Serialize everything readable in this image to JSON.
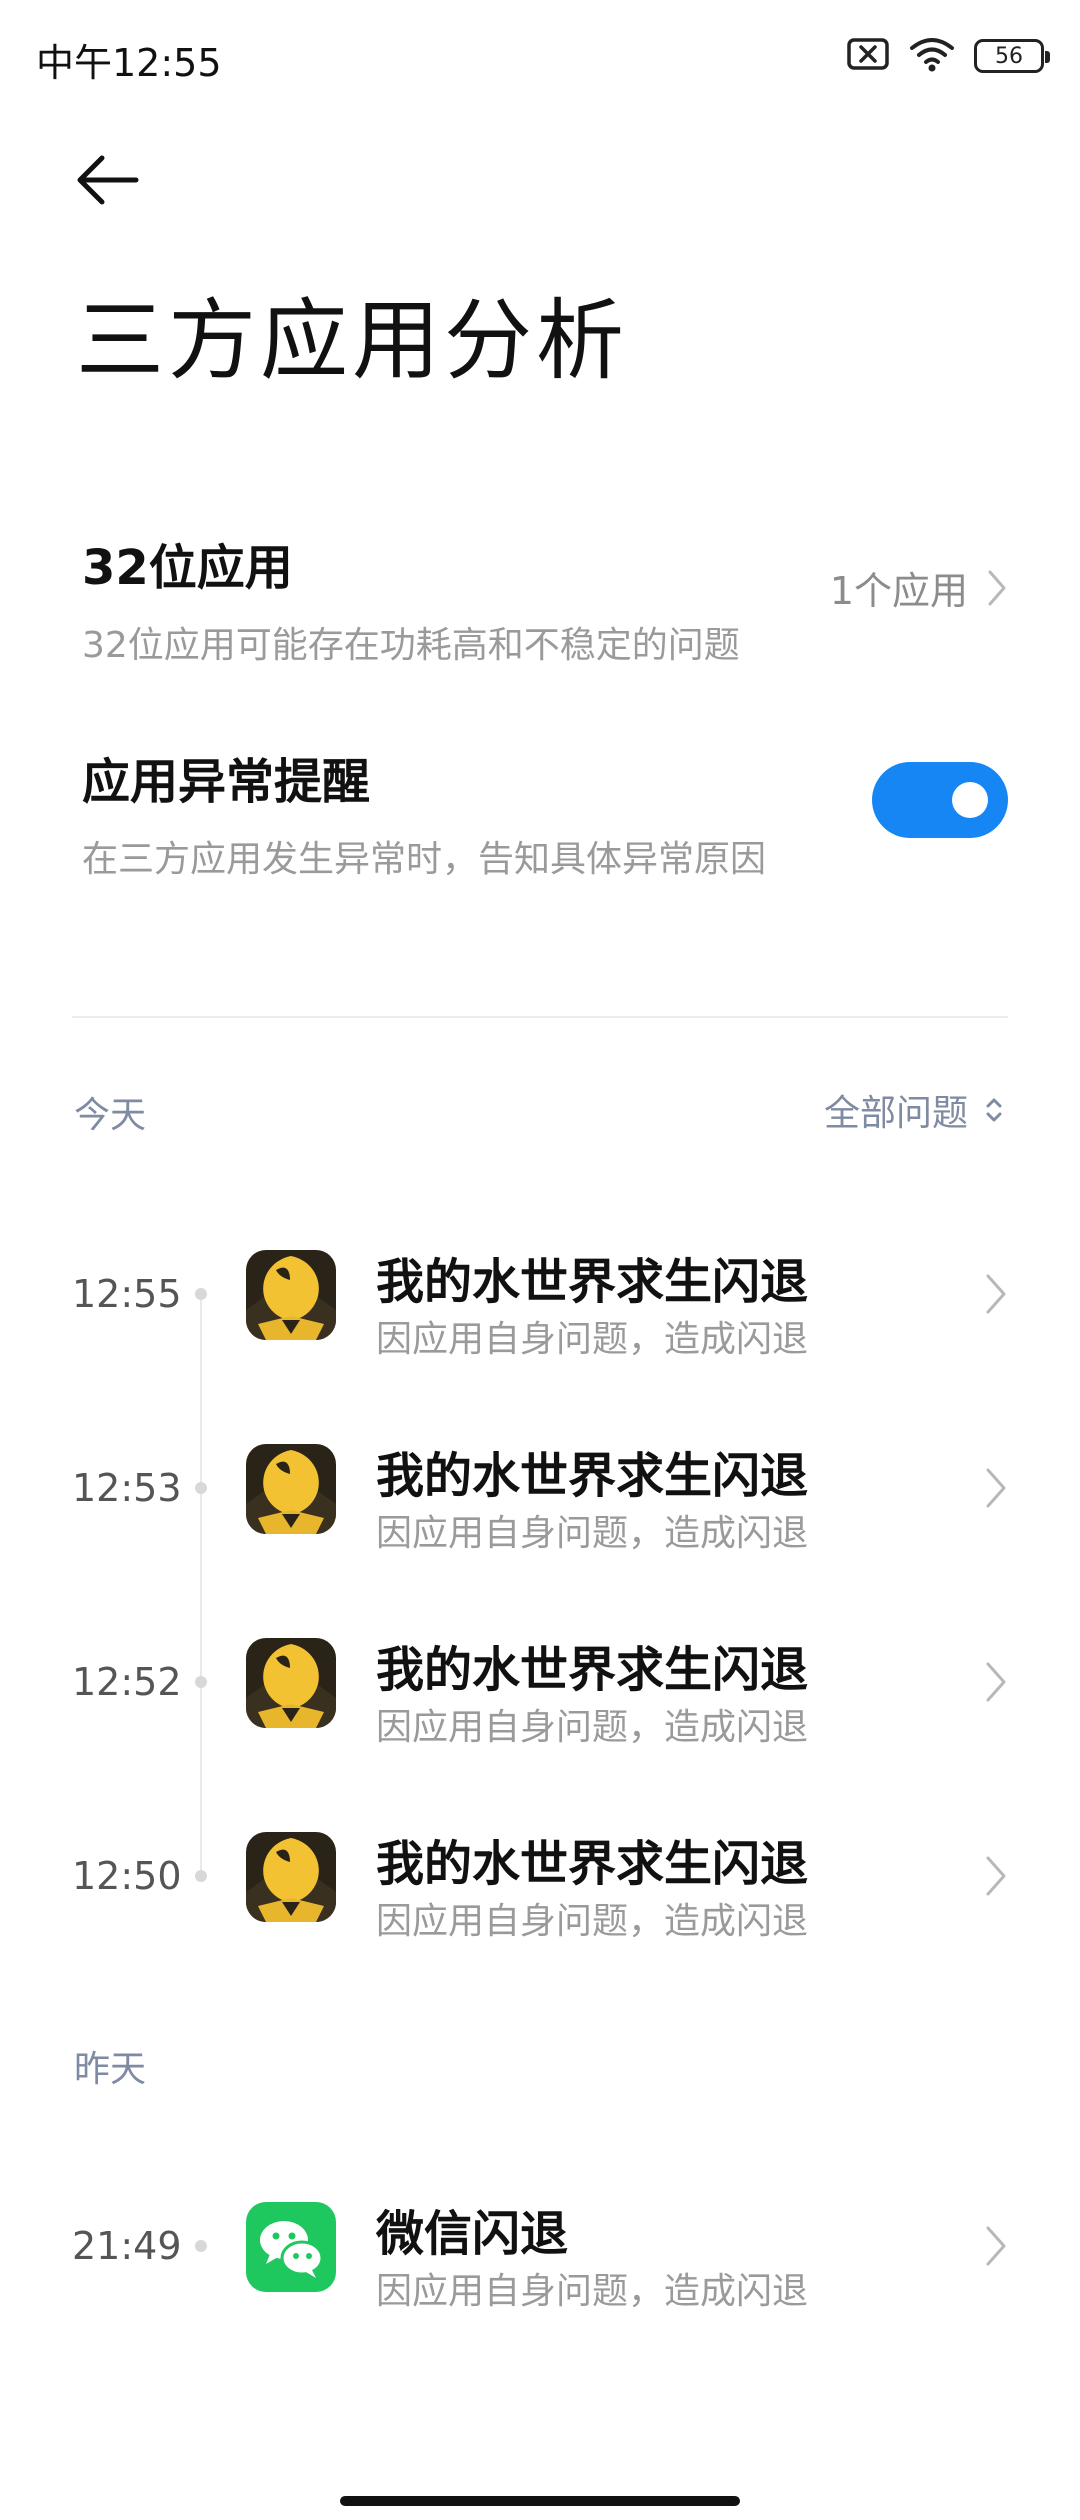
{
  "status_bar": {
    "time": "中午12:55",
    "battery": "56"
  },
  "header": {
    "title": "三方应用分析"
  },
  "settings": {
    "bit32": {
      "title": "32位应用",
      "subtitle": "32位应用可能存在功耗高和不稳定的问题",
      "value": "1个应用"
    },
    "alert": {
      "title": "应用异常提醒",
      "subtitle": "在三方应用发生异常时，告知具体异常原因",
      "enabled": true
    }
  },
  "sections": {
    "today": {
      "label": "今天",
      "filter_label": "全部问题",
      "entries": [
        {
          "time": "12:55",
          "title": "我的水世界求生闪退",
          "subtitle": "因应用自身问题，造成闪退",
          "icon": "water-world-game-icon"
        },
        {
          "time": "12:53",
          "title": "我的水世界求生闪退",
          "subtitle": "因应用自身问题，造成闪退",
          "icon": "water-world-game-icon"
        },
        {
          "time": "12:52",
          "title": "我的水世界求生闪退",
          "subtitle": "因应用自身问题，造成闪退",
          "icon": "water-world-game-icon"
        },
        {
          "time": "12:50",
          "title": "我的水世界求生闪退",
          "subtitle": "因应用自身问题，造成闪退",
          "icon": "water-world-game-icon"
        }
      ]
    },
    "yesterday": {
      "label": "昨天",
      "entries": [
        {
          "time": "21:49",
          "title": "微信闪退",
          "subtitle": "因应用自身问题，造成闪退",
          "icon": "wechat-icon"
        }
      ]
    }
  },
  "colors": {
    "accent": "#1686f5",
    "wechat_green": "#1fc75f",
    "game_gold": "#f2c233"
  }
}
